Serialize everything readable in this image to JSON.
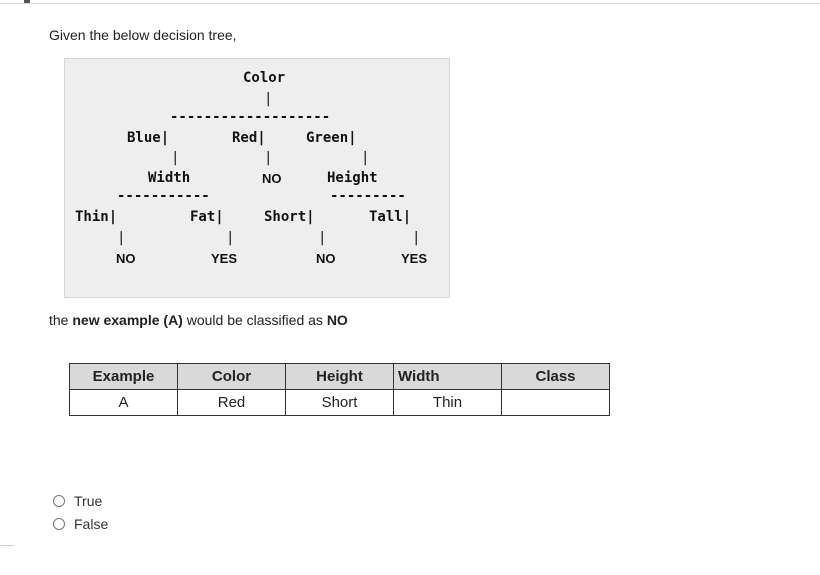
{
  "question": {
    "intro": "Given the below decision tree,"
  },
  "tree": {
    "root": "Color",
    "root_bar": "|",
    "root_dash": "-------------------",
    "blue": "Blue|",
    "red": "Red|",
    "green": "Green|",
    "bar": "|",
    "width": "Width",
    "red_leaf": "NO",
    "height": "Height",
    "width_dash": "-----------",
    "height_dash": "---------",
    "thin": "Thin|",
    "fat": "Fat|",
    "short": "Short|",
    "tall": "Tall|",
    "thin_leaf": "NO",
    "fat_leaf": "YES",
    "short_leaf": "NO",
    "tall_leaf": "YES"
  },
  "statement": {
    "part1": "the ",
    "bold1": "new example (A)",
    "part2": " would be classified as ",
    "bold2": "NO"
  },
  "table": {
    "headers": [
      "Example",
      "Color",
      "Height",
      "Width",
      "Class"
    ],
    "row": [
      "A",
      "Red",
      "Short",
      "Thin",
      ""
    ]
  },
  "options": [
    {
      "label": "True"
    },
    {
      "label": "False"
    }
  ]
}
